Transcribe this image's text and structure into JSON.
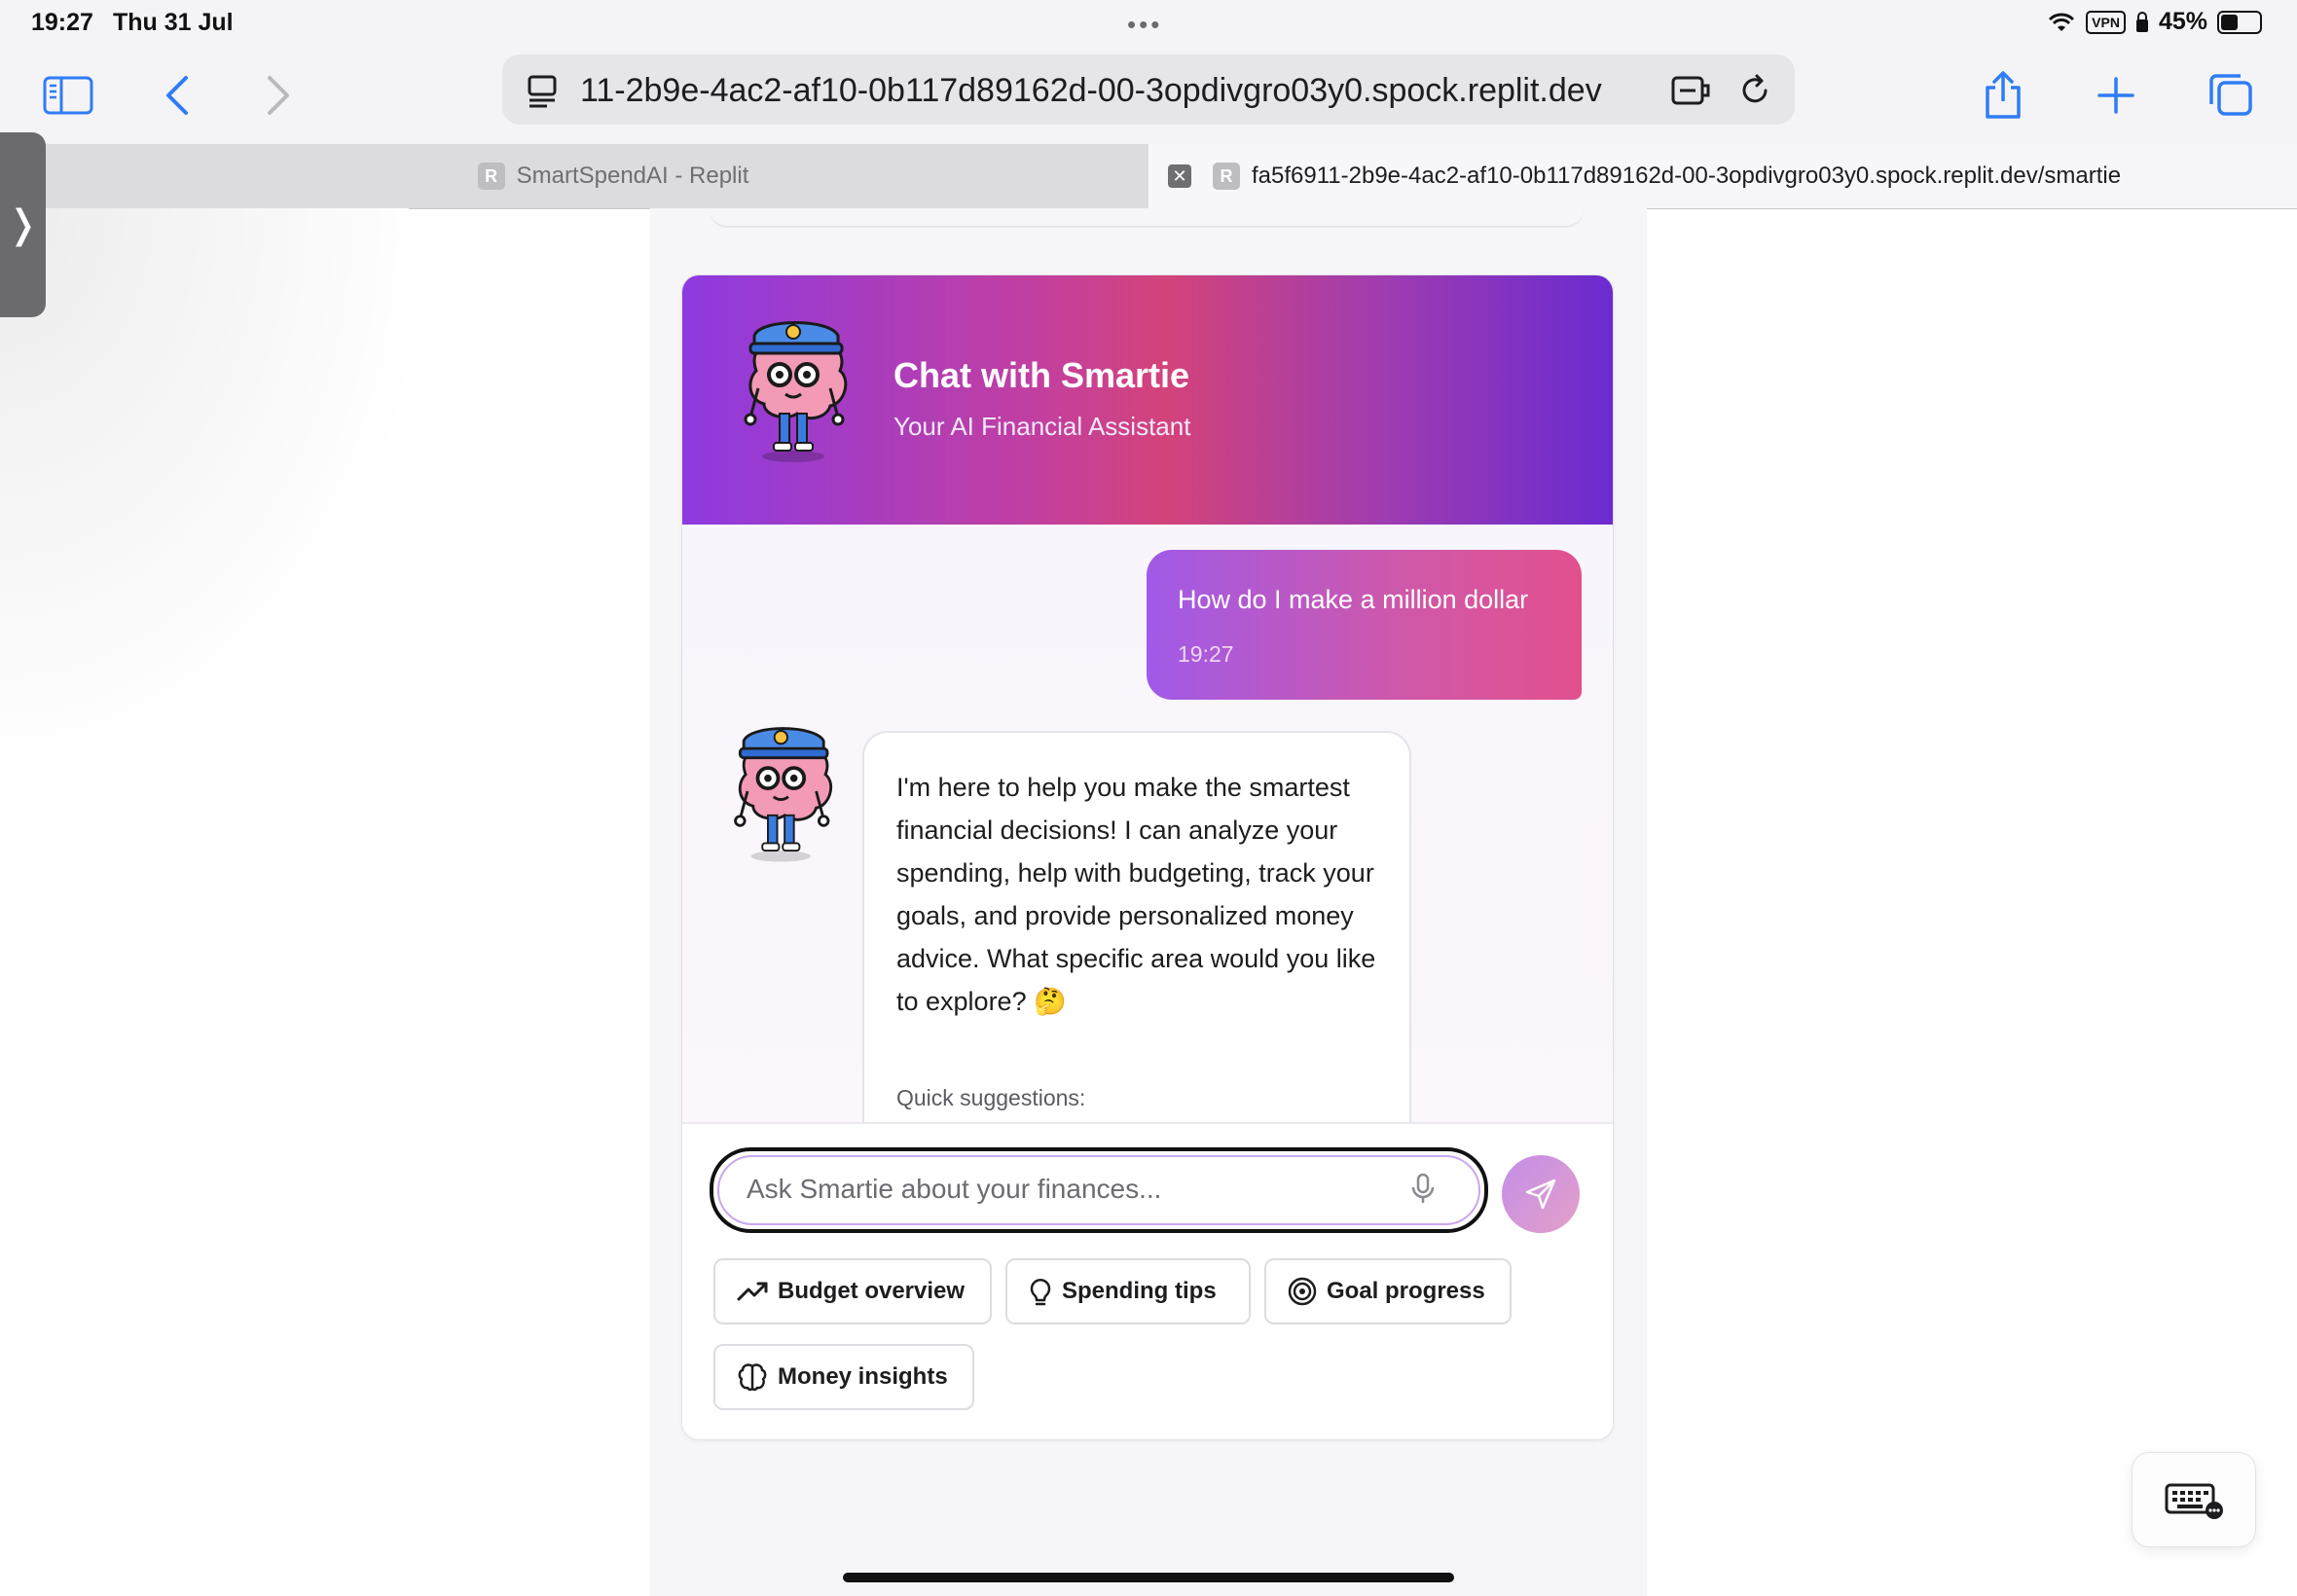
{
  "status_bar": {
    "time": "19:27",
    "date": "Thu 31 Jul",
    "vpn": "VPN",
    "battery": "45%"
  },
  "browser": {
    "url": "11-2b9e-4ac2-af10-0b117d89162d-00-3opdivgro03y0.spock.replit.dev",
    "tabs": [
      {
        "favicon": "R",
        "title": "SmartSpendAI - Replit"
      },
      {
        "favicon": "R",
        "title": "fa5f6911-2b9e-4ac2-af10-0b117d89162d-00-3opdivgro03y0.spock.replit.dev/smartie"
      }
    ]
  },
  "chat": {
    "title": "Chat with Smartie",
    "subtitle": "Your AI Financial Assistant",
    "messages": [
      {
        "role": "user",
        "text": "How do I make a million dollar",
        "time": "19:27"
      },
      {
        "role": "assistant",
        "text": "I'm here to help you make the smartest financial decisions! I can analyze your spending, help with budgeting, track your goals, and provide personalized money advice. What specific area would you like to explore? 🤔",
        "suggestions_label": "Quick suggestions:"
      }
    ],
    "input_placeholder": "Ask Smartie about your finances...",
    "quick_actions": [
      {
        "label": "Budget overview",
        "icon": "trending-up-icon"
      },
      {
        "label": "Spending tips",
        "icon": "lightbulb-icon"
      },
      {
        "label": "Goal progress",
        "icon": "target-icon"
      },
      {
        "label": "Money insights",
        "icon": "brain-icon"
      }
    ]
  },
  "colors": {
    "accent_purple": "#8d3ae0",
    "accent_pink": "#d3437a"
  }
}
